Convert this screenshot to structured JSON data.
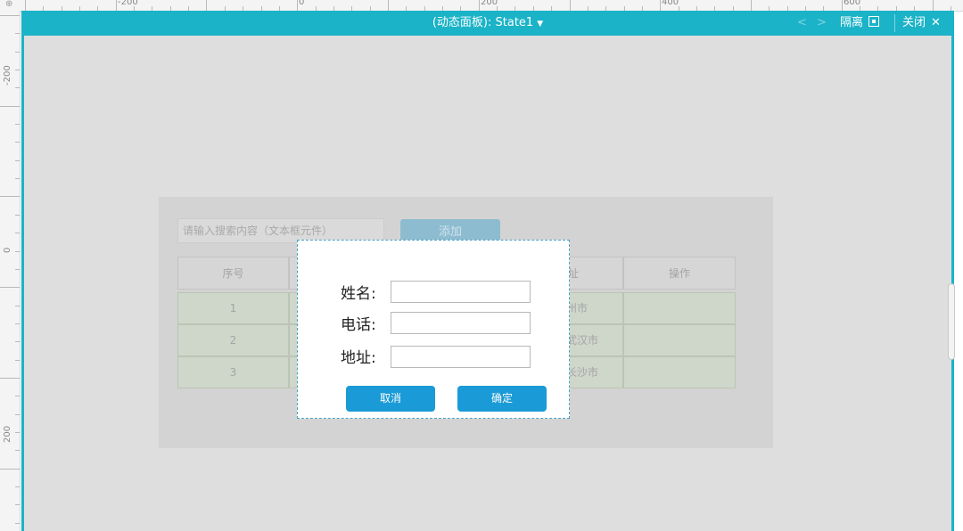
{
  "rulers": {
    "top_labels": [
      "-200",
      "0",
      "200",
      "400",
      "600"
    ],
    "left_labels": [
      "-200",
      "0",
      "200"
    ]
  },
  "panel_bar": {
    "state_label": "(动态面板): State1",
    "prev_glyph": "<",
    "next_glyph": ">",
    "isolate_label": "隔离",
    "close_label": "关闭",
    "icons": [
      "chevron-left-icon",
      "chevron-right-icon",
      "isolate-icon",
      "close-icon",
      "caret-down-icon"
    ]
  },
  "page": {
    "search_placeholder": "请输入搜索内容（文本框元件）",
    "add_button": "添加",
    "table": {
      "headers": [
        "序号",
        "",
        "",
        "址",
        "操作"
      ],
      "rows": [
        [
          "1",
          "",
          "",
          "州市",
          ""
        ],
        [
          "2",
          "",
          "",
          "武汉市",
          ""
        ],
        [
          "3",
          "",
          "",
          "长沙市",
          ""
        ]
      ]
    }
  },
  "modal": {
    "name_label": "姓名:",
    "phone_label": "电话:",
    "address_label": "地址:",
    "name_value": "",
    "phone_value": "",
    "address_value": "",
    "cancel_button": "取消",
    "confirm_button": "确定"
  },
  "colors": {
    "panel_accent": "#1bb3c7",
    "button_blue": "#1a9ad6",
    "canvas_bg": "#dedede"
  }
}
